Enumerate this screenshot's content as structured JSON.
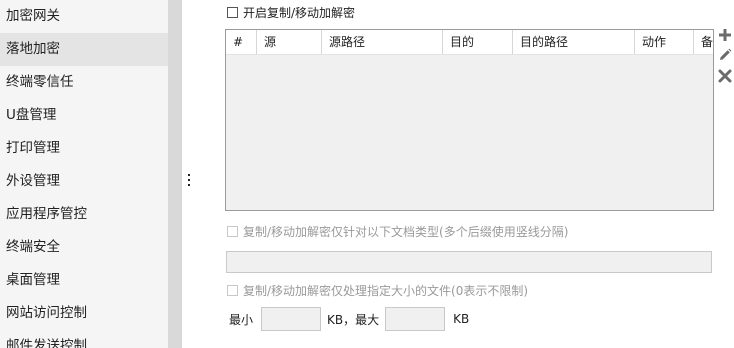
{
  "sidebar": {
    "items": [
      {
        "label": "加密网关"
      },
      {
        "label": "落地加密",
        "active": true
      },
      {
        "label": "终端零信任"
      },
      {
        "label": "U盘管理"
      },
      {
        "label": "打印管理"
      },
      {
        "label": "外设管理"
      },
      {
        "label": "应用程序管控"
      },
      {
        "label": "终端安全"
      },
      {
        "label": "桌面管理"
      },
      {
        "label": "网站访问控制"
      },
      {
        "label": "邮件发送控制"
      }
    ]
  },
  "main": {
    "enable_checkbox": {
      "label": "开启复制/移动加解密",
      "checked": false
    },
    "table": {
      "columns": [
        "#",
        "源",
        "源路径",
        "目的",
        "目的路径",
        "动作",
        "备注"
      ],
      "rows": []
    },
    "toolbar": {
      "add_icon": "plus-icon",
      "edit_icon": "pencil-icon",
      "delete_icon": "x-icon"
    },
    "type_filter": {
      "label": "复制/移动加解密仅针对以下文档类型(多个后缀使用竖线分隔)",
      "checked": false,
      "enabled": false,
      "value": ""
    },
    "size_filter": {
      "label": "复制/移动加解密仅处理指定大小的文件(0表示不限制)",
      "checked": false,
      "enabled": false,
      "min_label": "最小",
      "min_value": "",
      "unit_min": "KB，最大",
      "max_value": "",
      "unit_max": "KB"
    }
  },
  "colors": {
    "sidebar_bg": "#f5f5f5",
    "sidebar_active_bg": "#e4e4e4",
    "disabled_text": "#9a9a9a",
    "icon_gray": "#6b6b6b"
  }
}
